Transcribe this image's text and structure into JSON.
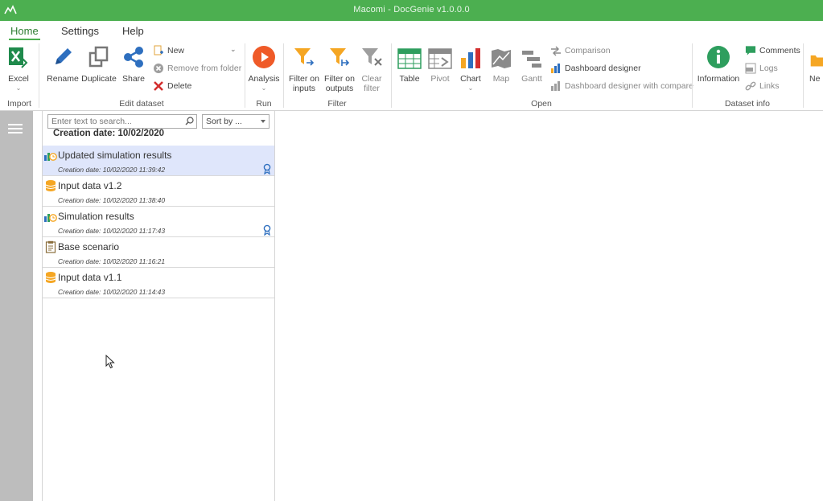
{
  "app": {
    "title": "Macomi - DocGenie v1.0.0.0"
  },
  "tabs": [
    {
      "label": "Home",
      "active": true
    },
    {
      "label": "Settings",
      "active": false
    },
    {
      "label": "Help",
      "active": false
    }
  ],
  "ribbon": {
    "import": {
      "label": "Import",
      "excel": "Excel"
    },
    "edit": {
      "label": "Edit dataset",
      "rename": "Rename",
      "duplicate": "Duplicate",
      "share": "Share",
      "new": "New",
      "remove_from_folder": "Remove from folder",
      "delete": "Delete"
    },
    "run": {
      "label": "Run",
      "analysis": "Analysis"
    },
    "filter": {
      "label": "Filter",
      "filter_inputs_1": "Filter on",
      "filter_inputs_2": "inputs",
      "filter_outputs_1": "Filter on",
      "filter_outputs_2": "outputs",
      "clear_1": "Clear",
      "clear_2": "filter"
    },
    "open": {
      "label": "Open",
      "table": "Table",
      "pivot": "Pivot",
      "chart": "Chart",
      "map": "Map",
      "gantt": "Gantt",
      "comparison": "Comparison",
      "dashboard_designer": "Dashboard designer",
      "dashboard_designer_compare": "Dashboard designer with compare"
    },
    "info": {
      "label": "Dataset info",
      "information": "Information",
      "comments": "Comments",
      "logs": "Logs",
      "links": "Links"
    },
    "extra": {
      "partial": "Ne"
    }
  },
  "panel": {
    "search_placeholder": "Enter text to search...",
    "sort_label": "Sort by ...",
    "group_header": "Creation date: 10/02/2020",
    "items": [
      {
        "name": "Updated simulation results",
        "date": "Creation date: 10/02/2020 11:39:42",
        "icon": "simulation-icon",
        "badge": true,
        "selected": true
      },
      {
        "name": "Input data v1.2",
        "date": "Creation date: 10/02/2020 11:38:40",
        "icon": "database-icon",
        "badge": false,
        "selected": false
      },
      {
        "name": "Simulation results",
        "date": "Creation date: 10/02/2020 11:17:43",
        "icon": "simulation-icon",
        "badge": true,
        "selected": false
      },
      {
        "name": "Base scenario",
        "date": "Creation date: 10/02/2020 11:16:21",
        "icon": "clipboard-icon",
        "badge": false,
        "selected": false
      },
      {
        "name": "Input data v1.1",
        "date": "Creation date: 10/02/2020 11:14:43",
        "icon": "database-icon",
        "badge": false,
        "selected": false
      }
    ]
  },
  "colors": {
    "accent": "#4caf50",
    "selected_row": "#dfe6fb",
    "sidebar": "#bdbdbd"
  }
}
